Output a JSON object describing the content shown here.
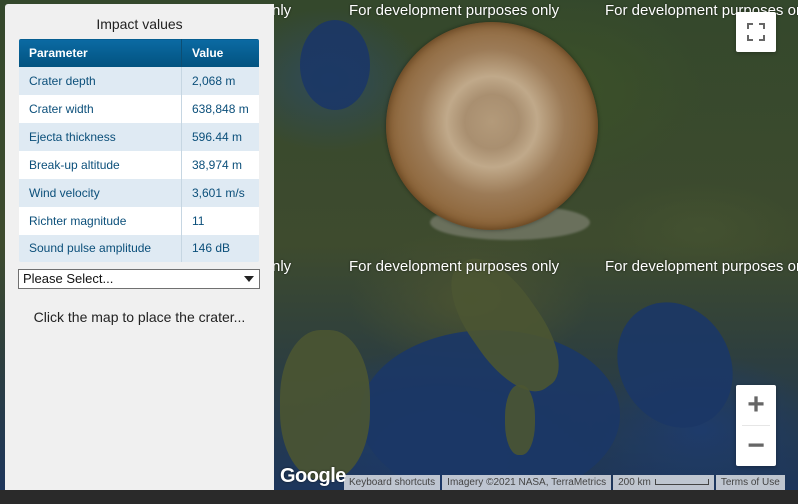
{
  "panel": {
    "title": "Impact values",
    "table": {
      "headers": [
        "Parameter",
        "Value"
      ],
      "rows": [
        {
          "param": "Crater depth",
          "value": "2,068 m"
        },
        {
          "param": "Crater width",
          "value": "638,848 m"
        },
        {
          "param": "Ejecta thickness",
          "value": "596.44 m"
        },
        {
          "param": "Break-up altitude",
          "value": "38,974 m"
        },
        {
          "param": "Wind velocity",
          "value": "3,601 m/s"
        },
        {
          "param": "Richter magnitude",
          "value": "11"
        },
        {
          "param": "Sound pulse amplitude",
          "value": "146 dB"
        }
      ]
    },
    "select": {
      "selected": "Please Select..."
    },
    "hint": "Click the map to place the crater..."
  },
  "map": {
    "watermarks": [
      "nly",
      "For development purposes only",
      "For development purposes only",
      "nly",
      "For development purposes only",
      "For development purposes only"
    ],
    "logo": "Google",
    "attribution": {
      "shortcuts": "Keyboard shortcuts",
      "imagery": "Imagery ©2021 NASA, TerraMetrics",
      "scale": "200 km",
      "terms": "Terms of Use"
    },
    "controls": {
      "fullscreen_icon": "fullscreen-icon",
      "zoom_in": "+",
      "zoom_out": "−"
    }
  },
  "colors": {
    "header_blue": "#0b6aa3",
    "row_tint": "#dfeaf3",
    "crater_brown": "#9c7b57"
  }
}
